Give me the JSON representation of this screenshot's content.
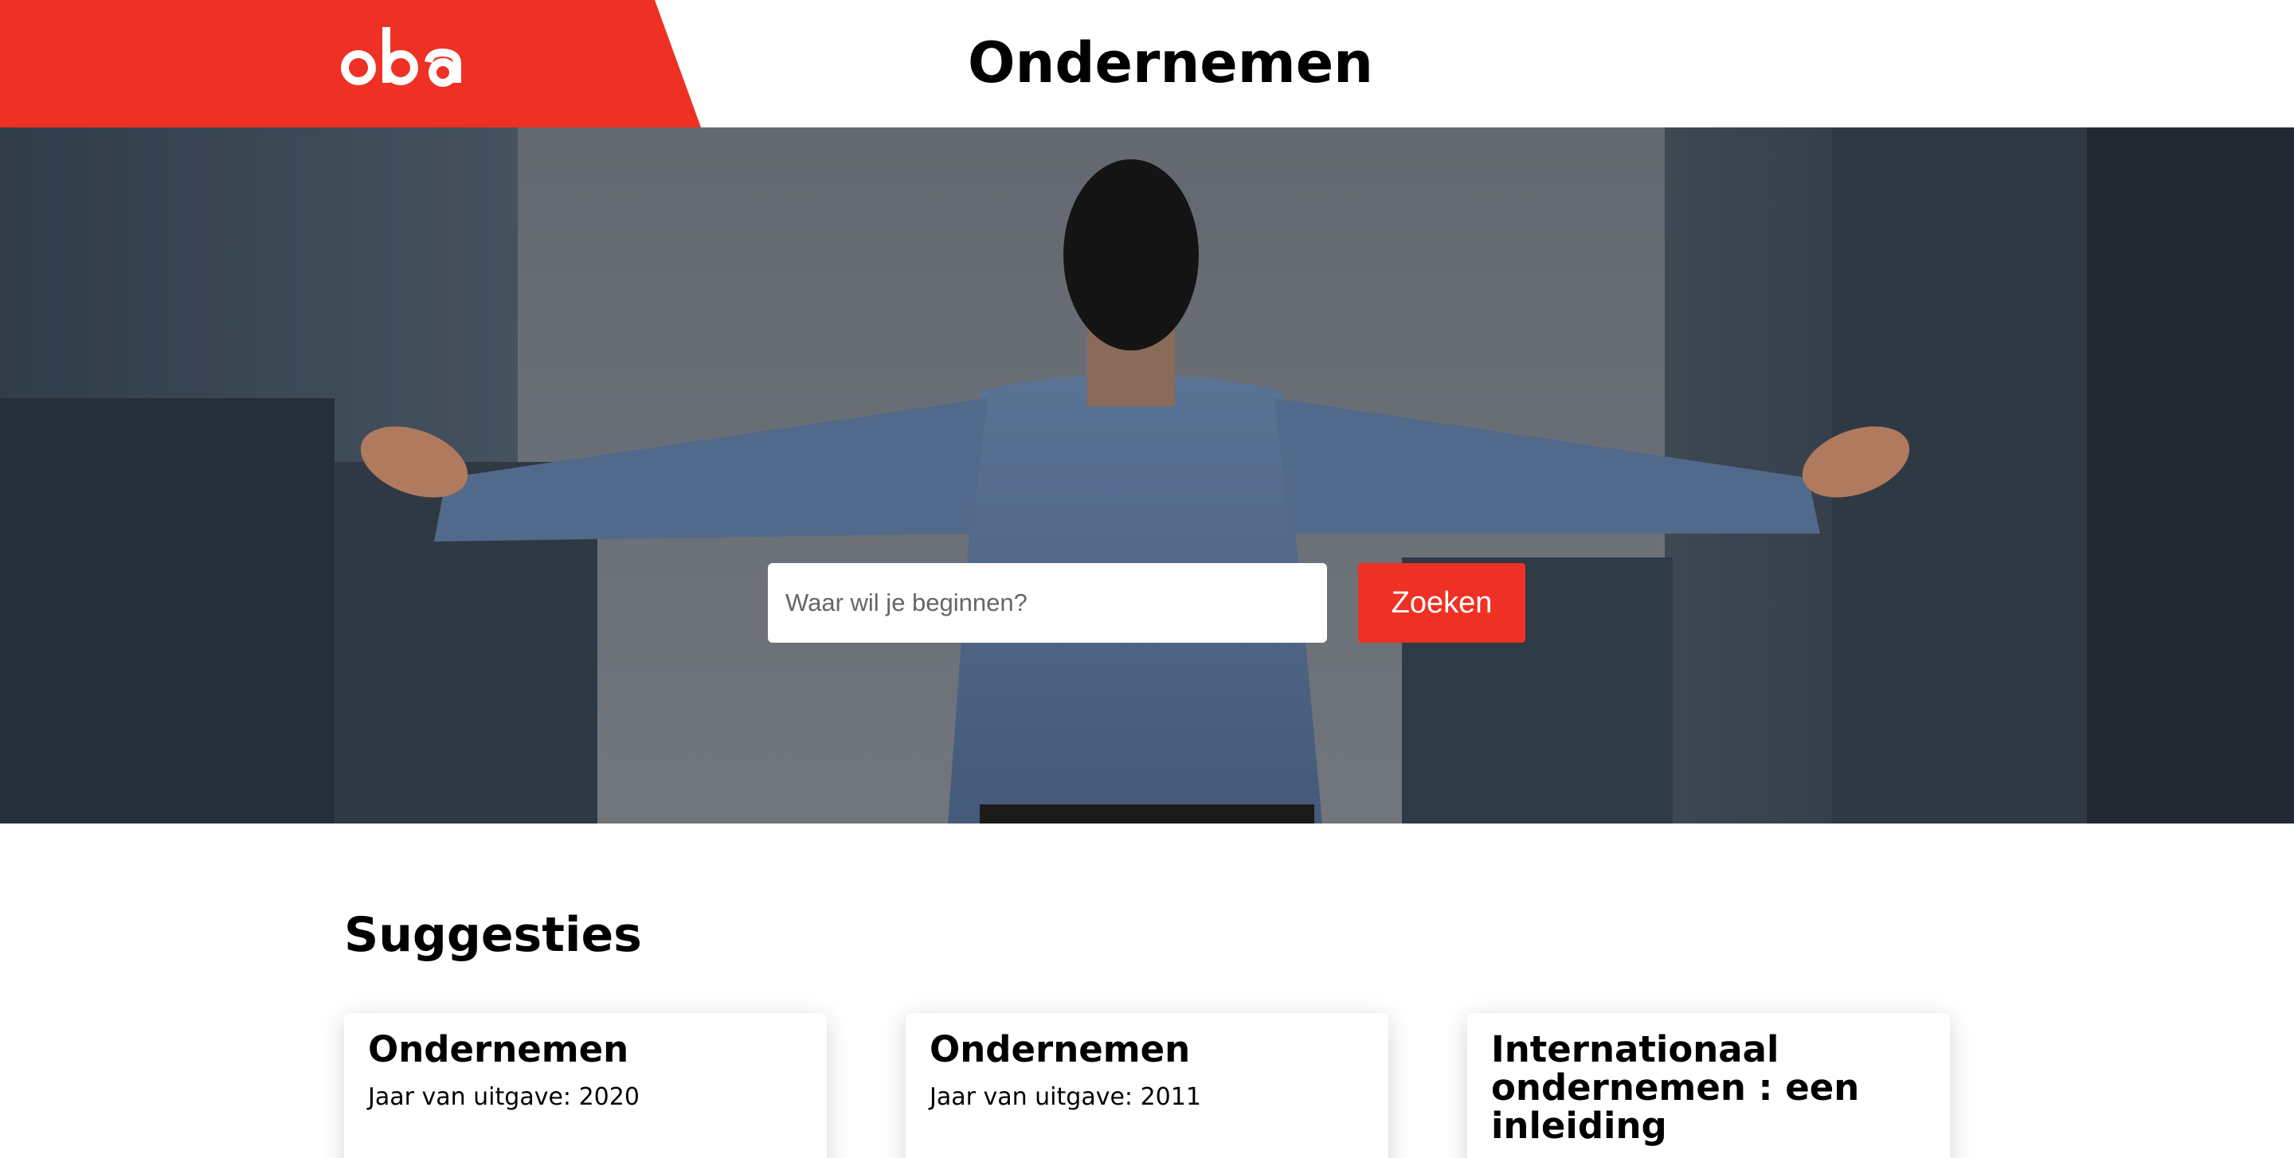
{
  "header": {
    "logo_text": "oba",
    "title": "Ondernemen",
    "brand_color": "#ee3124"
  },
  "search": {
    "placeholder": "Waar wil je beginnen?",
    "value": "",
    "button_label": "Zoeken"
  },
  "suggestions": {
    "heading": "Suggesties",
    "items": [
      {
        "title": "Ondernemen",
        "year_label": "Jaar van uitgave: 2020"
      },
      {
        "title": "Ondernemen",
        "year_label": "Jaar van uitgave: 2011"
      },
      {
        "title": "Internationaal ondernemen : een inleiding",
        "year_label": ""
      }
    ]
  }
}
